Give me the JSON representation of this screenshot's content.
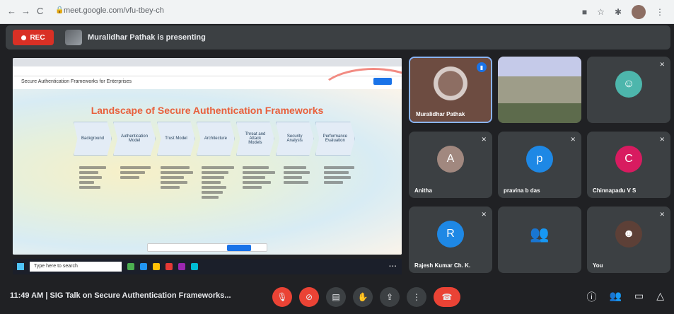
{
  "browser": {
    "url": "meet.google.com/vfu-tbey-ch",
    "nav_back": "←",
    "nav_forward": "→",
    "nav_reload": "C"
  },
  "meet_header": {
    "rec_label": "REC",
    "presenter_text": "Muralidhar Pathak is presenting"
  },
  "presentation": {
    "tab_text": "",
    "url_text": "",
    "doc_title": "Secure Authentication Frameworks for Enterprises",
    "slide_title": "Landscape of Secure Authentication Frameworks",
    "steps": [
      "Background",
      "Authentication Model",
      "Trust Model",
      "Architecture",
      "Threat and Attack Models",
      "Security Analysis",
      "Performance Evaluation"
    ],
    "footer_text": "",
    "taskbar_search": "Type here to search"
  },
  "participants": [
    {
      "name": "Muralidhar Pathak",
      "initial": "",
      "color": "#5f6368",
      "muted": false,
      "speaking": true
    },
    {
      "name": "",
      "initial": "",
      "color": "#7a8a6a",
      "muted": false,
      "speaking": false
    },
    {
      "name": "",
      "initial": "",
      "color": "#4db6ac",
      "muted": true,
      "speaking": false
    },
    {
      "name": "Anitha",
      "initial": "A",
      "color": "#a1887f",
      "muted": true,
      "speaking": false
    },
    {
      "name": "pravina b das",
      "initial": "p",
      "color": "#1e88e5",
      "muted": true,
      "speaking": false
    },
    {
      "name": "Chinnapadu V S",
      "initial": "C",
      "color": "#d81b60",
      "muted": true,
      "speaking": false
    },
    {
      "name": "Rajesh Kumar Ch. K.",
      "initial": "R",
      "color": "#1e88e5",
      "muted": true,
      "speaking": false
    },
    {
      "name": "",
      "initial": "",
      "color": "#3c4043",
      "muted": false,
      "speaking": false
    },
    {
      "name": "You",
      "initial": "",
      "color": "#5d4037",
      "muted": true,
      "speaking": false
    }
  ],
  "bottom_bar": {
    "meeting_info": "11:49 AM  |  SIG Talk on Secure Authentication Frameworks..."
  }
}
